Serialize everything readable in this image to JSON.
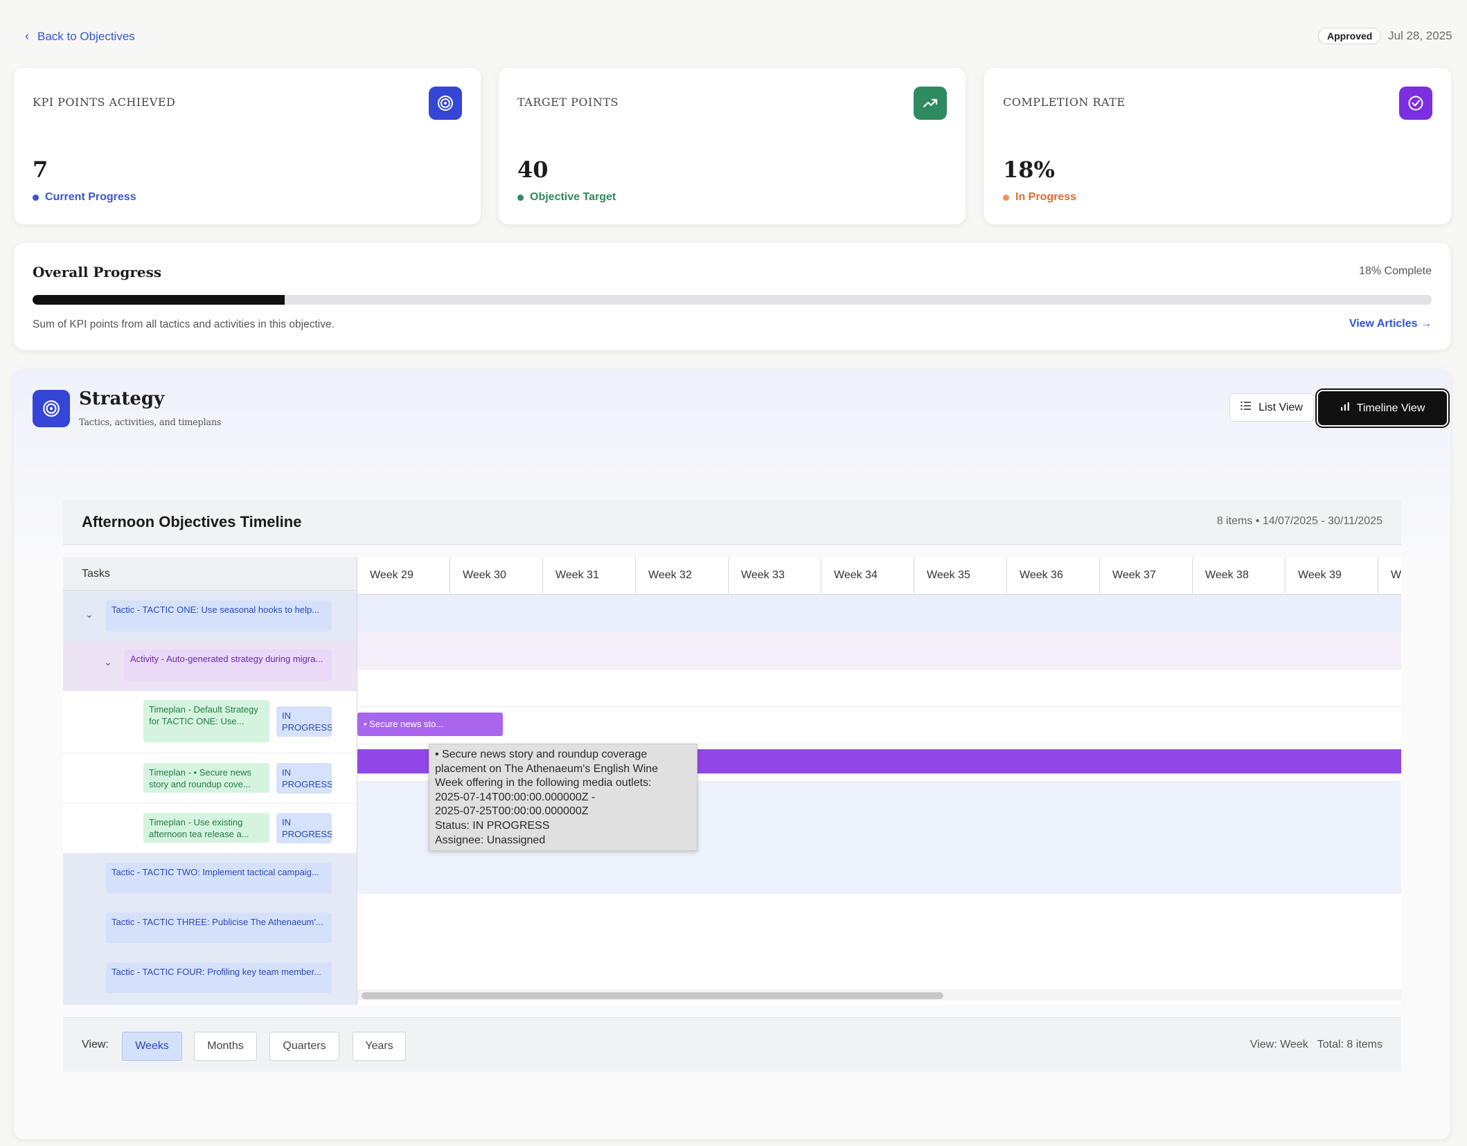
{
  "header": {
    "back_label": "Back to Objectives",
    "status": "Approved",
    "date": "Jul 28, 2025"
  },
  "kpis": [
    {
      "label": "KPI POINTS ACHIEVED",
      "value": "7",
      "sub": "Current Progress",
      "icon": "target-icon",
      "color": "#3545d6",
      "sub_color": "#3a55d8"
    },
    {
      "label": "TARGET POINTS",
      "value": "40",
      "sub": "Objective Target",
      "icon": "trending-up-icon",
      "color": "#2e8a5f",
      "sub_color": "#2e8a5f"
    },
    {
      "label": "COMPLETION RATE",
      "value": "18%",
      "sub": "In Progress",
      "icon": "check-circle-icon",
      "color": "#7c2ee0",
      "sub_color": "#e06a2e"
    }
  ],
  "progress": {
    "title": "Overall Progress",
    "percent_label": "18% Complete",
    "value": 0.18,
    "description": "Sum of KPI points from all tactics and activities in this objective.",
    "link": "View Articles →"
  },
  "strategy": {
    "title": "Strategy",
    "subtitle": "Tactics, activities, and timeplans",
    "list_view": "List View",
    "timeline_view": "Timeline View"
  },
  "timeline": {
    "title": "Afternoon Objectives Timeline",
    "meta": "8 items • 14/07/2025 - 30/11/2025",
    "tasks_header": "Tasks",
    "weeks": [
      "Week 29",
      "Week 30",
      "Week 31",
      "Week 32",
      "Week 33",
      "Week 34",
      "Week 35",
      "Week 36",
      "Week 37",
      "Week 38",
      "Week 39",
      "We"
    ],
    "tasks": [
      {
        "kind": "tactic",
        "label": "Tactic - TACTIC ONE: Use seasonal hooks to help...",
        "caret": true
      },
      {
        "kind": "activity",
        "label": "Activity - Auto-generated strategy during migra...",
        "caret": true
      },
      {
        "kind": "timeplan",
        "label": "Timeplan - Default Strategy for TACTIC ONE: Use...",
        "status": "IN PROGRESS"
      },
      {
        "kind": "timeplan",
        "label": "Timeplan - • Secure news story and roundup cove...",
        "status": "IN PROGRESS"
      },
      {
        "kind": "timeplan",
        "label": "Timeplan - Use existing afternoon tea release a...",
        "status": "IN PROGRESS"
      },
      {
        "kind": "tactic",
        "label": "Tactic - TACTIC TWO: Implement tactical campaig..."
      },
      {
        "kind": "tactic",
        "label": "Tactic - TACTIC THREE: Publicise The Athenaeum'..."
      },
      {
        "kind": "tactic",
        "label": "Tactic - TACTIC FOUR: Profiling key team member..."
      }
    ],
    "bars": [
      {
        "label": "• Secure news sto...",
        "color": "#a866ee"
      },
      {
        "label": "",
        "color": "#9247e8"
      }
    ],
    "tooltip": [
      "•       Secure news story and roundup coverage",
      "placement on The Athenaeum's English Wine",
      "Week offering in the following media outlets:",
      "2025-07-14T00:00:00.000000Z -",
      "2025-07-25T00:00:00.000000Z",
      "Status: IN PROGRESS",
      "Assignee: Unassigned"
    ]
  },
  "footer": {
    "view_label": "View:",
    "buttons": [
      "Weeks",
      "Months",
      "Quarters",
      "Years"
    ],
    "active": "Weeks",
    "right": "View: Week   Total: 8 items"
  }
}
